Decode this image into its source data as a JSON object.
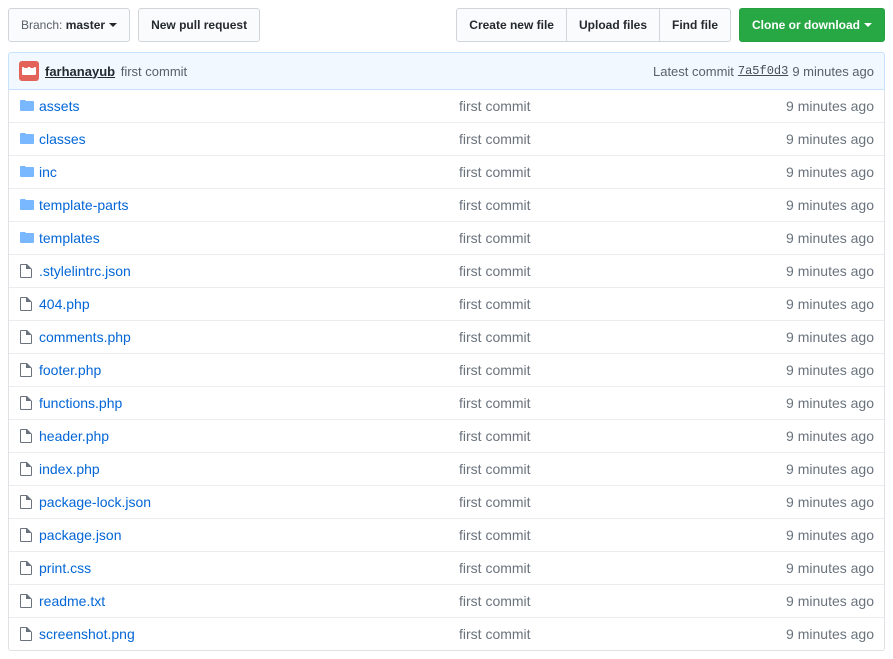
{
  "toolbar": {
    "branch_label_prefix": "Branch:",
    "branch_name": "master",
    "new_pr": "New pull request",
    "create_file": "Create new file",
    "upload_files": "Upload files",
    "find_file": "Find file",
    "clone": "Clone or download"
  },
  "tease": {
    "author": "farhanayub",
    "message": "first commit",
    "latest_label": "Latest commit",
    "sha": "7a5f0d3",
    "age": "9 minutes ago"
  },
  "files": [
    {
      "type": "dir",
      "name": "assets",
      "msg": "first commit",
      "age": "9 minutes ago"
    },
    {
      "type": "dir",
      "name": "classes",
      "msg": "first commit",
      "age": "9 minutes ago"
    },
    {
      "type": "dir",
      "name": "inc",
      "msg": "first commit",
      "age": "9 minutes ago"
    },
    {
      "type": "dir",
      "name": "template-parts",
      "msg": "first commit",
      "age": "9 minutes ago"
    },
    {
      "type": "dir",
      "name": "templates",
      "msg": "first commit",
      "age": "9 minutes ago"
    },
    {
      "type": "file",
      "name": ".stylelintrc.json",
      "msg": "first commit",
      "age": "9 minutes ago"
    },
    {
      "type": "file",
      "name": "404.php",
      "msg": "first commit",
      "age": "9 minutes ago"
    },
    {
      "type": "file",
      "name": "comments.php",
      "msg": "first commit",
      "age": "9 minutes ago"
    },
    {
      "type": "file",
      "name": "footer.php",
      "msg": "first commit",
      "age": "9 minutes ago"
    },
    {
      "type": "file",
      "name": "functions.php",
      "msg": "first commit",
      "age": "9 minutes ago"
    },
    {
      "type": "file",
      "name": "header.php",
      "msg": "first commit",
      "age": "9 minutes ago"
    },
    {
      "type": "file",
      "name": "index.php",
      "msg": "first commit",
      "age": "9 minutes ago"
    },
    {
      "type": "file",
      "name": "package-lock.json",
      "msg": "first commit",
      "age": "9 minutes ago"
    },
    {
      "type": "file",
      "name": "package.json",
      "msg": "first commit",
      "age": "9 minutes ago"
    },
    {
      "type": "file",
      "name": "print.css",
      "msg": "first commit",
      "age": "9 minutes ago"
    },
    {
      "type": "file",
      "name": "readme.txt",
      "msg": "first commit",
      "age": "9 minutes ago"
    },
    {
      "type": "file",
      "name": "screenshot.png",
      "msg": "first commit",
      "age": "9 minutes ago"
    }
  ]
}
